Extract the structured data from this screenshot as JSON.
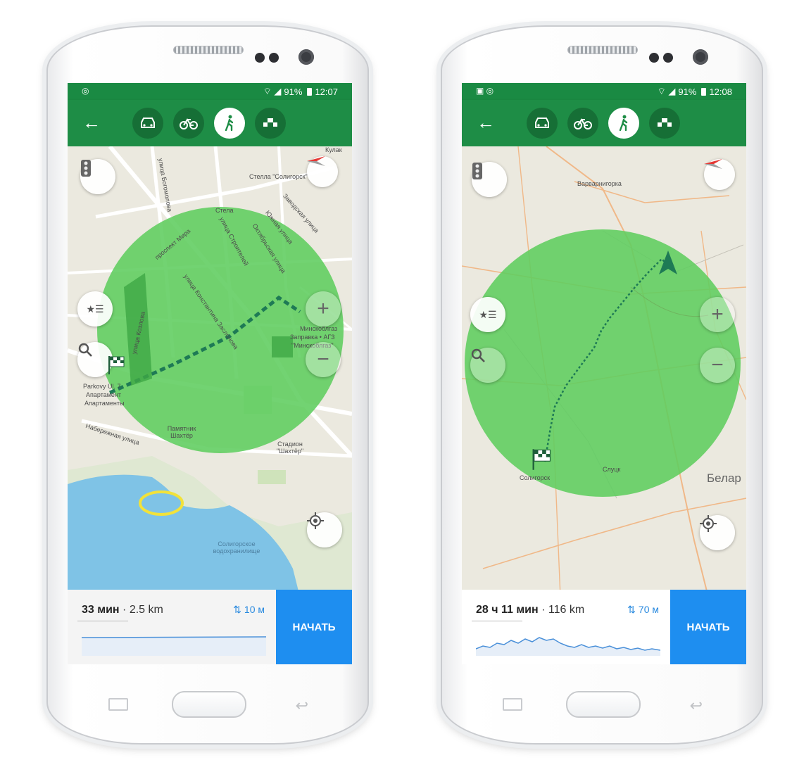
{
  "phones": [
    {
      "status": {
        "time": "12:07",
        "battery": "91%"
      },
      "map_labels": {
        "stela_name": "Стелла \"Солигорск\"",
        "stela": "Стела",
        "kulak": "Кулак",
        "prospekt_mira": "проспект Мира",
        "ul_stroiteley": "улица Строителей",
        "ul_oktyabrskaya": "Октябрьская улица",
        "ul_yuzhnaya": "Южная улица",
        "ul_zavodskaya": "Заводская улица",
        "ul_bogomolova": "улица Богомолова",
        "ul_kozlova": "улица Козлова",
        "ul_zaslonova": "улица Константина Заслонова",
        "minsk_oblgaz": "Минскоблгаз",
        "zapravka": "Заправка • АГЗ",
        "minsk_oblgaz_q": "\"Минскоблгаз\"",
        "parkovy": "Parkovy Ul. 7",
        "apartment": "Апартамент",
        "apartament2": "Апартаменты",
        "pamyatnik": "Памятник Шахтёр",
        "stadion": "Стадион \"Шахтёр\"",
        "naberezhnaya": "Набережная улица",
        "reservoir": "Солигорское водохранилище"
      },
      "summary": {
        "time": "33 мин",
        "distance": "2.5 km",
        "elevation": "10 м"
      },
      "start_label": "НАЧАТЬ",
      "icons": [
        "back-arrow-icon",
        "car-icon",
        "bike-icon",
        "walk-icon",
        "taxi-icon",
        "traffic-light-icon",
        "compass-icon",
        "bookmarks-icon",
        "search-icon",
        "zoom-in-icon",
        "zoom-out-icon",
        "my-location-icon",
        "finish-flag-icon"
      ]
    },
    {
      "status": {
        "time": "12:08",
        "battery": "91%"
      },
      "map_labels": {
        "village_top": "Варварнигорка",
        "soligorsk": "Солигорск",
        "slutsk": "Слуцк",
        "belarus": "Белар"
      },
      "summary": {
        "time": "28 ч 11 мин",
        "distance": "116 km",
        "elevation": "70 м"
      },
      "start_label": "НАЧАТЬ",
      "icons": [
        "back-arrow-icon",
        "car-icon",
        "bike-icon",
        "walk-icon",
        "taxi-icon",
        "traffic-light-icon",
        "compass-icon",
        "bookmarks-icon",
        "search-icon",
        "zoom-in-icon",
        "zoom-out-icon",
        "my-location-icon",
        "finish-flag-icon",
        "navigation-arrow-icon"
      ]
    }
  ],
  "colors": {
    "app_green": "#1e8d46",
    "status_green": "#1a8a43",
    "highlight_circle": "#5fcd5f",
    "start_blue": "#1e8ef0",
    "elevation_blue": "#2a8adf",
    "route": "#1e7a55"
  }
}
